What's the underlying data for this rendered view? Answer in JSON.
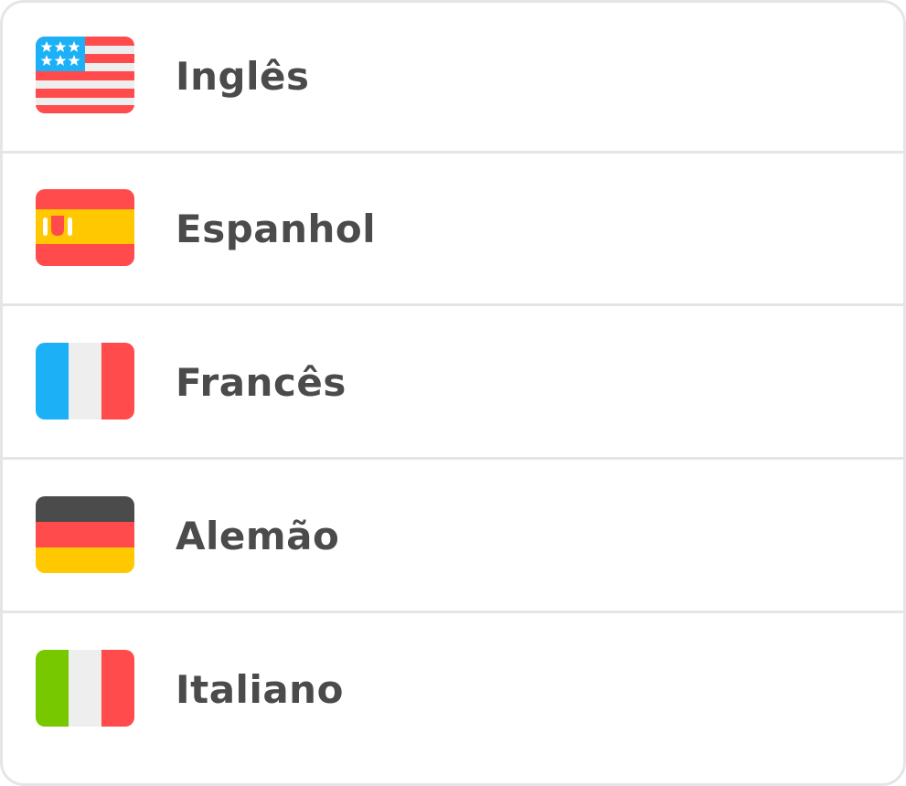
{
  "languages": [
    {
      "label": "Inglês",
      "flag": "us-flag-icon"
    },
    {
      "label": "Espanhol",
      "flag": "spain-flag-icon"
    },
    {
      "label": "Francês",
      "flag": "france-flag-icon"
    },
    {
      "label": "Alemão",
      "flag": "germany-flag-icon"
    },
    {
      "label": "Italiano",
      "flag": "italy-flag-icon"
    }
  ],
  "colors": {
    "text": "#4b4b4b",
    "border": "#e5e5e5",
    "red": "#ff4b4b",
    "blue": "#1cb0f6",
    "white": "#eeeeee",
    "yellow": "#ffc800",
    "dark": "#4b4b4b",
    "green": "#78c800"
  }
}
